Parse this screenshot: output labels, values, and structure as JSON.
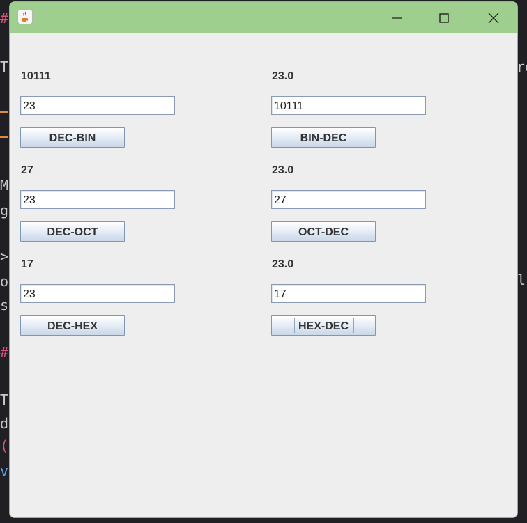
{
  "background": {
    "fragments": [
      "#",
      "T",
      "re",
      "M",
      "g",
      ">",
      "o",
      "s",
      "l",
      "#",
      "T",
      "d",
      "(",
      "v"
    ]
  },
  "window": {
    "controls": {
      "minimize_icon": "minimize-icon",
      "maximize_icon": "maximize-icon",
      "close_icon": "close-icon"
    },
    "converters": [
      {
        "result": "10111",
        "input": "23",
        "button": "DEC-BIN"
      },
      {
        "result": "23.0",
        "input": "10111",
        "button": "BIN-DEC"
      },
      {
        "result": "27",
        "input": "23",
        "button": "DEC-OCT"
      },
      {
        "result": "23.0",
        "input": "27",
        "button": "OCT-DEC"
      },
      {
        "result": "17",
        "input": "23",
        "button": "DEC-HEX"
      },
      {
        "result": "23.0",
        "input": "17",
        "button": "HEX-DEC"
      }
    ]
  },
  "colors": {
    "titlebar": "#9ecf8e",
    "window_bg": "#eeeeee",
    "page_bg": "#1f1f24"
  }
}
